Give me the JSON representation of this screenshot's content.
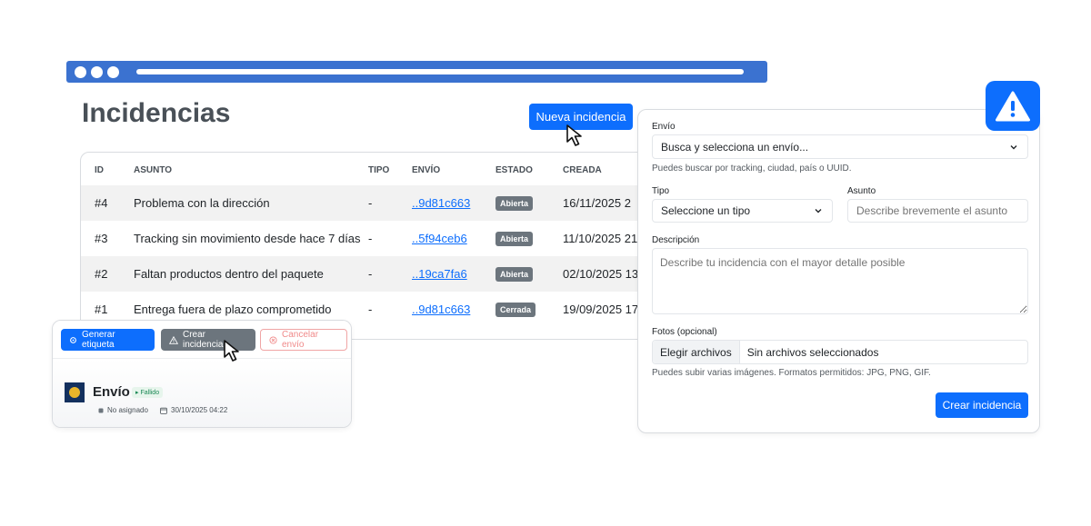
{
  "page": {
    "title": "Incidencias",
    "new_button": "Nueva incidencia"
  },
  "table": {
    "headers": [
      "ID",
      "ASUNTO",
      "TIPO",
      "ENVÍO",
      "ESTADO",
      "CREADA"
    ],
    "rows": [
      {
        "id": "#4",
        "asunto": "Problema con la dirección",
        "tipo": "-",
        "envio": "..9d81c663",
        "estado": "Abierta",
        "creada": "16/11/2025 2"
      },
      {
        "id": "#3",
        "asunto": "Tracking sin movimiento desde hace 7 días",
        "tipo": "-",
        "envio": "..5f94ceb6",
        "estado": "Abierta",
        "creada": "11/10/2025 21"
      },
      {
        "id": "#2",
        "asunto": "Faltan productos dentro del paquete",
        "tipo": "-",
        "envio": "..19ca7fa6",
        "estado": "Abierta",
        "creada": "02/10/2025 13"
      },
      {
        "id": "#1",
        "asunto": "Entrega fuera de plazo comprometido",
        "tipo": "-",
        "envio": "..9d81c663",
        "estado": "Cerrada",
        "creada": "19/09/2025 17"
      }
    ]
  },
  "shipment_card": {
    "generate_label": "Generar etiqueta",
    "create_incident": "Crear incidencia",
    "cancel_shipment": "Cancelar envío",
    "title": "Envío",
    "status": "Fallido",
    "assignee": "No asignado",
    "date": "30/10/2025 04:22"
  },
  "form": {
    "envio_label": "Envío",
    "envio_value": "Busca y selecciona un envío...",
    "envio_help": "Puedes buscar por tracking, ciudad, país o UUID.",
    "tipo_label": "Tipo",
    "tipo_value": "Seleccione un tipo",
    "asunto_label": "Asunto",
    "asunto_placeholder": "Describe brevemente el asunto",
    "descripcion_label": "Descripción",
    "descripcion_placeholder": "Describe tu incidencia con el mayor detalle posible",
    "fotos_label": "Fotos (opcional)",
    "file_button": "Elegir archivos",
    "file_status": "Sin archivos seleccionados",
    "fotos_help": "Puedes subir varias imágenes. Formatos permitidos: JPG, PNG, GIF.",
    "submit": "Crear incidencia"
  },
  "colors": {
    "primary": "#0d6efd",
    "browser_bar": "#3b72d0",
    "badge": "#6c757d",
    "success": "#198754",
    "danger": "#f08a8a"
  },
  "icons": [
    "warning-icon",
    "gear-icon",
    "cancel-circle-icon",
    "chevron-down-icon",
    "calendar-icon",
    "user-dot-icon",
    "cursor-arrow-icon"
  ]
}
